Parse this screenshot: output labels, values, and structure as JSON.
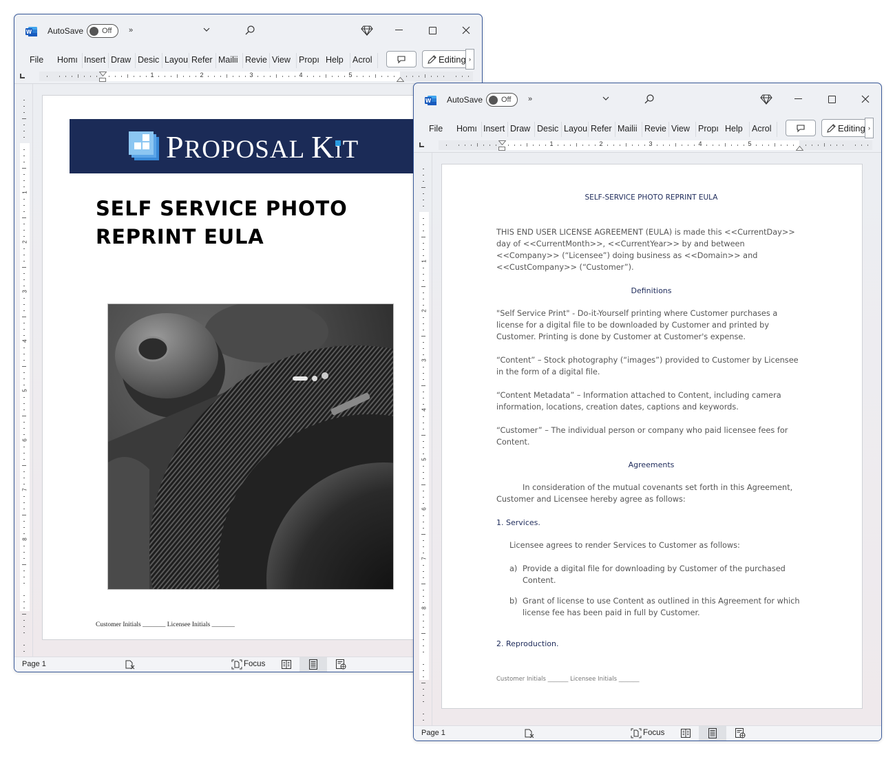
{
  "windows": [
    {
      "id": "left",
      "titlebar": {
        "autosave_label": "AutoSave",
        "autosave_state": "Off",
        "more_label": "»"
      },
      "ribbon": {
        "tabs": [
          "File",
          "Home",
          "Insert",
          "Draw",
          "Design",
          "Layout",
          "References",
          "Mailings",
          "Review",
          "View",
          "Properties",
          "Help",
          "Acrobat"
        ],
        "tabs_display": [
          "File",
          "Homı",
          "Insert",
          "Draw",
          "Desic",
          "Layou",
          "Refer",
          "Mailii",
          "Revie",
          "View",
          "Propı",
          "Help",
          "Acrol"
        ],
        "editing_label": "Editing",
        "more_label": "›"
      },
      "ruler": {
        "numbers": [
          "1",
          "2",
          "3",
          "4",
          "5"
        ]
      },
      "vruler": {
        "numbers": [
          "1",
          "2",
          "3",
          "4",
          "5",
          "6",
          "7",
          "8"
        ]
      },
      "page": {
        "banner_brand": "Proposal Kit",
        "banner_brand_parts": [
          "P",
          "ROPOSAL ",
          "K",
          "i",
          "T"
        ],
        "title": "SELF SERVICE PHOTO\nREPRINT EULA",
        "footer": "Customer Initials _______ Licensee Initials _______"
      },
      "status": {
        "page": "Page 1",
        "focus_label": "Focus"
      }
    },
    {
      "id": "right",
      "titlebar": {
        "autosave_label": "AutoSave",
        "autosave_state": "Off",
        "more_label": "»"
      },
      "ribbon": {
        "tabs": [
          "File",
          "Home",
          "Insert",
          "Draw",
          "Design",
          "Layout",
          "References",
          "Mailings",
          "Review",
          "View",
          "Properties",
          "Help",
          "Acrobat"
        ],
        "tabs_display": [
          "File",
          "Homı",
          "Insert",
          "Draw",
          "Desic",
          "Layou",
          "Refer",
          "Mailii",
          "Revie",
          "View",
          "Propı",
          "Help",
          "Acrol"
        ],
        "editing_label": "Editing",
        "more_label": "›"
      },
      "ruler": {
        "numbers": [
          "1",
          "2",
          "3",
          "4",
          "5"
        ]
      },
      "vruler": {
        "numbers": [
          "1",
          "2",
          "3",
          "4",
          "5",
          "6",
          "7",
          "8"
        ]
      },
      "page": {
        "title": "SELF-SERVICE PHOTO REPRINT EULA",
        "intro": "THIS END USER LICENSE AGREEMENT (EULA) is made this <<CurrentDay>> day of <<CurrentMonth>>, <<CurrentYear>> by and between <<Company>> (“Licensee”) doing business as <<Domain>> and <<CustCompany>> (“Customer”).",
        "definitions_heading": "Definitions",
        "definitions": [
          "\"Self Service Print\" - Do-it-Yourself printing where Customer purchases a license for a digital file to be downloaded by Customer and printed by Customer. Printing is done by Customer at Customer's expense.",
          "“Content” – Stock photography (“images”) provided to Customer by Licensee in the form of a digital file.",
          "“Content Metadata” – Information attached to Content, including camera information, locations, creation dates, captions and keywords.",
          "“Customer” – The individual person or company who paid licensee fees for Content."
        ],
        "agreements_heading": "Agreements",
        "agreements_intro": "In consideration of the mutual covenants set forth in this Agreement, Customer and Licensee hereby agree as follows:",
        "section1_heading": "1. Services.",
        "section1_intro": "Licensee agrees to render Services to Customer as follows:",
        "section1_items": [
          {
            "letter": "a)",
            "text": "Provide a digital file for downloading by Customer of the purchased Content."
          },
          {
            "letter": "b)",
            "text": "Grant of license to use Content as outlined in this Agreement for which license fee has been paid in full by Customer."
          }
        ],
        "section2_heading": "2. Reproduction.",
        "footer": "Customer Initials _______ Licensee Initials _______"
      },
      "status": {
        "page": "Page 1",
        "focus_label": "Focus"
      }
    }
  ],
  "colors": {
    "banner_bg": "#1b2b57",
    "heading_navy": "#1d2a5a",
    "word_blue": "#185abd",
    "window_border": "#3a5a9a"
  },
  "icons": {
    "app": "word-icon",
    "toggle": "toggle-switch",
    "overflow": "chevrons-right-icon",
    "dropdown": "chevron-down-icon",
    "search": "search-icon",
    "premium": "diamond-icon",
    "minimize": "minimize-icon",
    "maximize": "maximize-icon",
    "close": "close-icon",
    "comment": "comment-icon",
    "edit": "pencil-icon",
    "accessibility": "text-predictions-icon",
    "focus": "focus-icon",
    "read_mode": "read-mode-icon",
    "print_layout": "print-layout-icon",
    "web_layout": "web-layout-icon"
  }
}
